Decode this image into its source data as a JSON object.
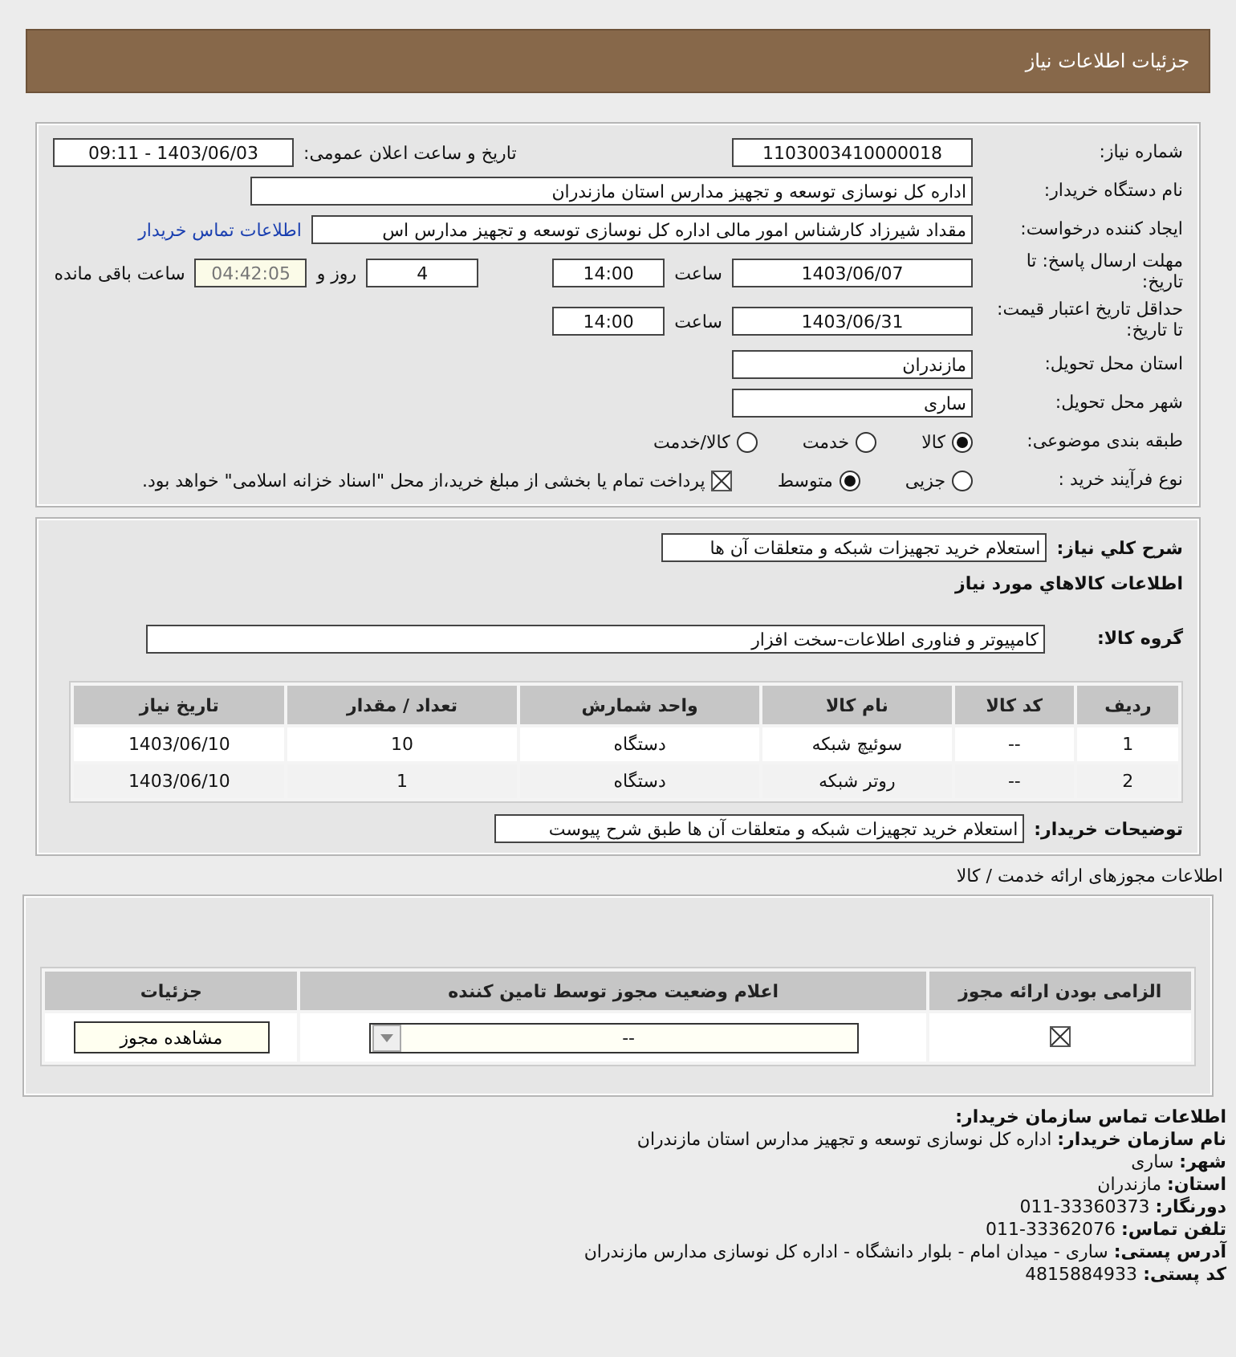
{
  "header": {
    "title": "جزئیات اطلاعات نیاز"
  },
  "need": {
    "number": {
      "label": "شماره نیاز:",
      "value": "1103003410000018"
    },
    "announce": {
      "label": "تاریخ و ساعت اعلان عمومی:",
      "value": "1403/06/03 - 09:11"
    },
    "buyer": {
      "label": "نام دستگاه خریدار:",
      "value": "اداره کل نوسازی  توسعه و تجهیز مدارس استان مازندران"
    },
    "requester": {
      "label": "ایجاد کننده درخواست:",
      "value": "مقداد شیرزاد کارشناس امور مالی اداره کل نوسازی  توسعه و تجهیز مدارس اس",
      "link": "اطلاعات تماس خریدار"
    },
    "deadline": {
      "label": "مهلت ارسال پاسخ: تا تاریخ:",
      "date": "1403/06/07",
      "time_label": "ساعت",
      "time": "14:00",
      "days": "4",
      "days_label": "روز و",
      "remaining": "04:42:05",
      "remaining_label": "ساعت باقی مانده"
    },
    "validity": {
      "label": "حداقل تاریخ اعتبار قیمت: تا تاریخ:",
      "date": "1403/06/31",
      "time_label": "ساعت",
      "time": "14:00"
    },
    "province": {
      "label": "استان محل تحویل:",
      "value": "مازندران"
    },
    "city": {
      "label": "شهر محل تحویل:",
      "value": "ساری"
    },
    "category": {
      "label": "طبقه بندی موضوعی:",
      "options": [
        {
          "label": "کالا",
          "selected": true
        },
        {
          "label": "خدمت",
          "selected": false
        },
        {
          "label": "کالا/خدمت",
          "selected": false
        }
      ]
    },
    "purchase": {
      "label": "نوع فرآیند خرید :",
      "options": [
        {
          "label": "جزیی",
          "selected": false
        },
        {
          "label": "متوسط",
          "selected": true
        }
      ],
      "payment": {
        "checked": true,
        "label": "پرداخت تمام یا بخشی از مبلغ خرید،از محل \"اسناد خزانه اسلامی\" خواهد بود."
      }
    }
  },
  "details": {
    "summary": {
      "label": "شرح کلي نیاز:",
      "value": "استعلام خرید تجهیزات شبکه و متعلقات آن ها"
    },
    "goods_heading": "اطلاعات کالاهاي مورد نیاز",
    "group": {
      "label": "گروه کالا:",
      "value": "کامپیوتر و فناوری اطلاعات-سخت افزار"
    },
    "table": {
      "columns": [
        "ردیف",
        "کد کالا",
        "نام کالا",
        "واحد شمارش",
        "تعداد / مقدار",
        "تاریخ نیاز"
      ],
      "rows": [
        [
          "1",
          "--",
          "سوئیچ شبکه",
          "دستگاه",
          "10",
          "1403/06/10"
        ],
        [
          "2",
          "--",
          "روتر شبکه",
          "دستگاه",
          "1",
          "1403/06/10"
        ]
      ]
    },
    "notes": {
      "label": "توضیحات خریدار:",
      "value": "استعلام خرید تجهیزات شبکه و متعلقات آن ها طبق شرح پیوست"
    }
  },
  "permits": {
    "heading": "اطلاعات مجوزهای ارائه خدمت / کالا",
    "columns": [
      "الزامی بودن ارائه مجوز",
      "اعلام وضعیت مجوز توسط تامین کننده",
      "جزئیات"
    ],
    "rows": [
      {
        "required": true,
        "status": "--",
        "button": "مشاهده مجوز"
      }
    ]
  },
  "contact": {
    "heading": "اطلاعات تماس سازمان خریدار:",
    "lines": [
      {
        "label": "نام سازمان خریدار:",
        "value": "اداره کل نوسازی توسعه و تجهیز مدارس استان مازندران"
      },
      {
        "label": "شهر:",
        "value": "ساری"
      },
      {
        "label": "استان:",
        "value": "مازندران"
      },
      {
        "label": "دورنگار:",
        "value": "33360373-011"
      },
      {
        "label": "تلفن تماس:",
        "value": "33362076-011"
      },
      {
        "label": "آدرس پستی:",
        "value": "ساری - میدان امام - بلوار دانشگاه - اداره کل نوسازی مدارس مازندران"
      },
      {
        "label": "کد پستی:",
        "value": "4815884933"
      }
    ]
  }
}
